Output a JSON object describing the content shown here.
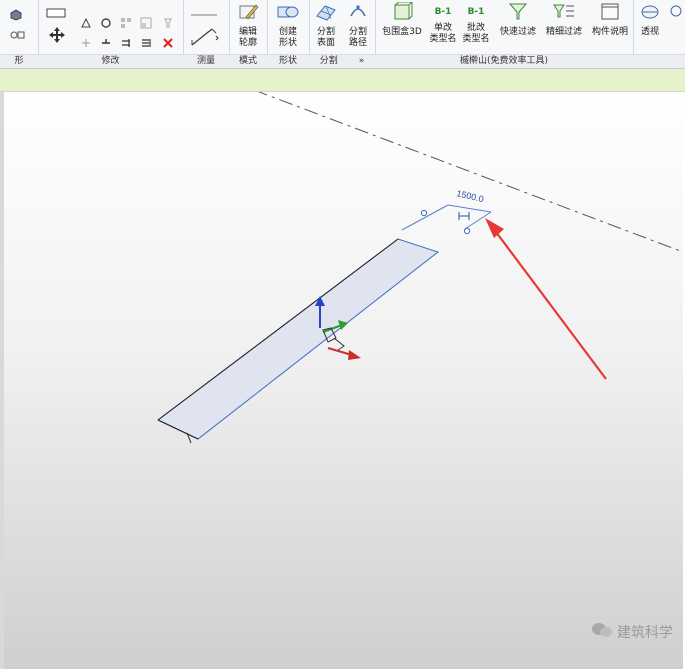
{
  "ribbon": {
    "panels": [
      {
        "label": "形"
      },
      {
        "label": "修改"
      },
      {
        "label": "测量"
      },
      {
        "label": "模式"
      },
      {
        "label": "形状"
      },
      {
        "label": "分割",
        "expander": "»"
      },
      {
        "label": "槭檊山(免费效率工具)"
      }
    ],
    "buttons": {
      "edit_profile": [
        "编辑",
        "轮廓"
      ],
      "create_shape": [
        "创建",
        "形状"
      ],
      "divide_surface": [
        "分割",
        "表面"
      ],
      "divide_path": [
        "分割",
        "路径"
      ],
      "bounding_box_3d": "包围盒3D",
      "single_rename_type": [
        "单改",
        "类型名"
      ],
      "batch_rename_type": [
        "批改",
        "类型名"
      ],
      "quick_filter": "快速过滤",
      "fine_filter": "精细过滤",
      "component_description": "构件说明",
      "perspective": "透视",
      "b1_badge": "B-1"
    }
  },
  "viewport": {
    "dimension_value": "1500.0"
  },
  "watermark": {
    "text": "建筑科学"
  },
  "colors": {
    "options_bar": "#e5f3cc",
    "selection_blue": "#3d67c9",
    "arrow_red": "#e53935",
    "face_fill": "#dfe4ee"
  }
}
